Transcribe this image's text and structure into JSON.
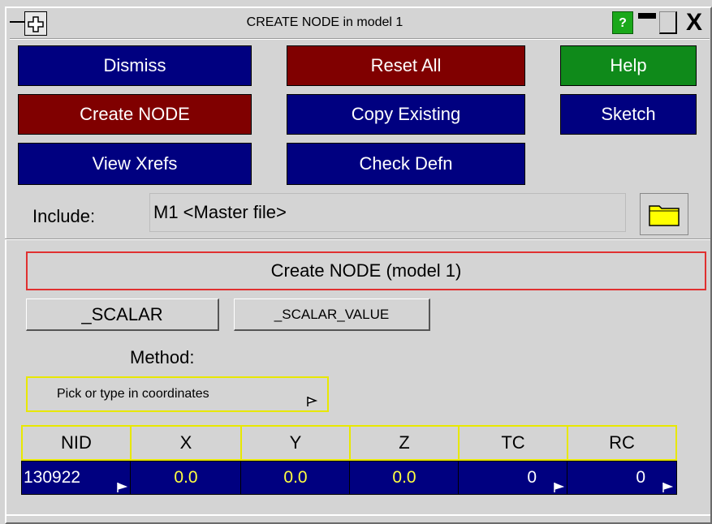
{
  "window": {
    "title": "CREATE NODE in model 1",
    "help_icon": "?",
    "close_icon": "X"
  },
  "toolbar": {
    "dismiss": "Dismiss",
    "reset_all": "Reset All",
    "help": "Help",
    "create_node": "Create NODE",
    "copy_existing": "Copy Existing",
    "sketch": "Sketch",
    "view_xrefs": "View Xrefs",
    "check_defn": "Check Defn"
  },
  "include": {
    "label": "Include:",
    "value": "M1  <Master file>",
    "browse_icon": "folder-icon"
  },
  "panel": {
    "title": "Create NODE (model 1)",
    "scalar_button": "_SCALAR",
    "scalar_value_button": "_SCALAR_VALUE",
    "method_label": "Method:",
    "method_value": "Pick or type in coordinates"
  },
  "table": {
    "headers": [
      "NID",
      "X",
      "Y",
      "Z",
      "TC",
      "RC"
    ],
    "row": {
      "nid": "130922",
      "x": "0.0",
      "y": "0.0",
      "z": "0.0",
      "tc": "0",
      "rc": "0"
    }
  },
  "colors": {
    "button_blue": "#000080",
    "button_red": "#800000",
    "button_green": "#0f8a1a",
    "highlight_yellow": "#e8e800",
    "panel_border_red": "#e03030"
  }
}
